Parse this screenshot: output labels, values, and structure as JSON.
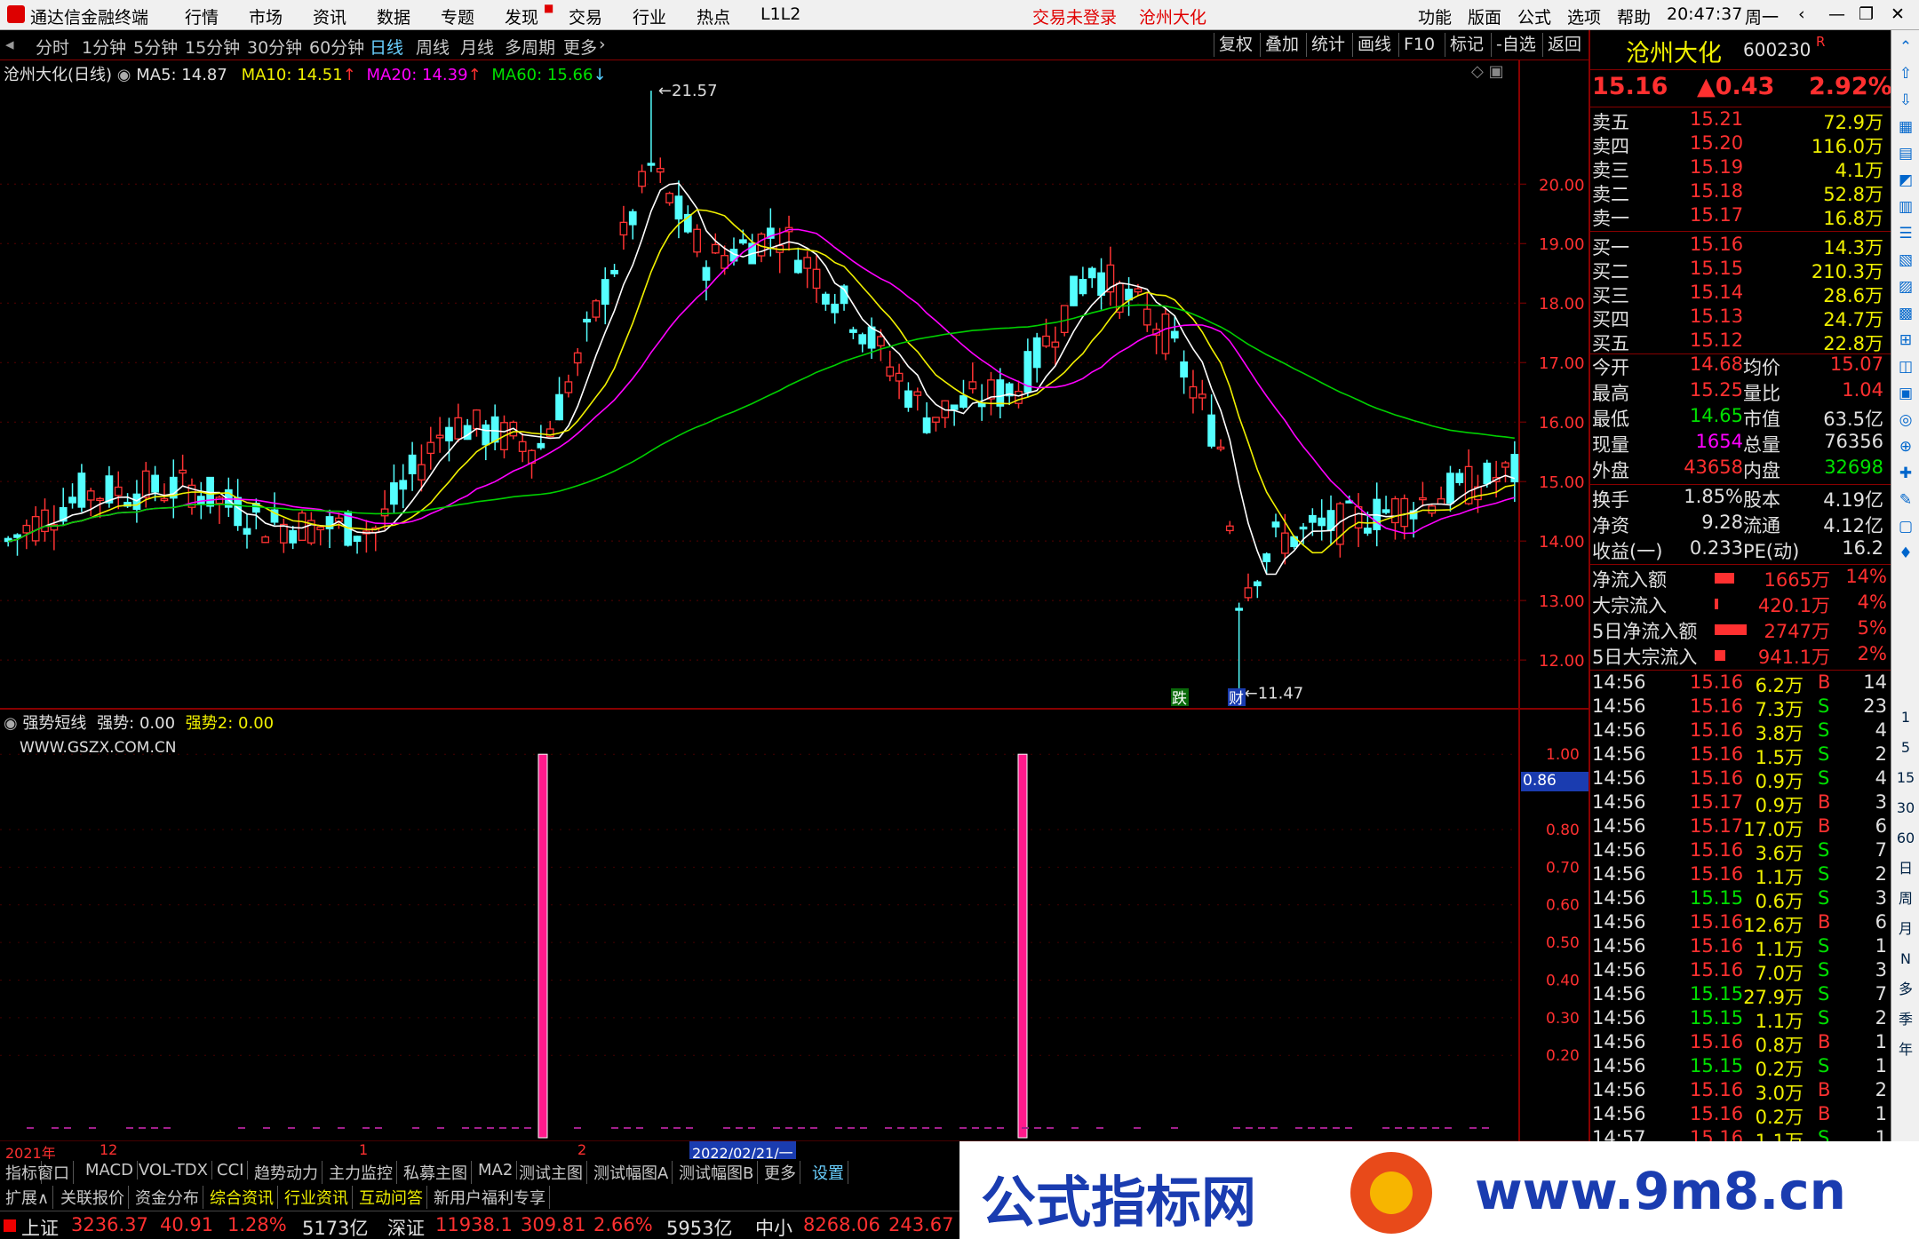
{
  "titlebar": {
    "app": "通达信金融终端",
    "menus": [
      "行情",
      "市场",
      "资讯",
      "数据",
      "专题",
      "发现",
      "交易",
      "行业",
      "热点",
      "L1L2"
    ],
    "status": "交易未登录",
    "stock": "沧州大化",
    "right_menus": [
      "功能",
      "版面",
      "公式",
      "选项",
      "帮助"
    ],
    "time": "20:47:37",
    "weekday": "周一"
  },
  "toolbar": {
    "periods": [
      "分时",
      "1分钟",
      "5分钟",
      "15分钟",
      "30分钟",
      "60分钟",
      "日线",
      "周线",
      "月线",
      "多周期",
      "更多"
    ],
    "active": "日线",
    "buttons": [
      "复权",
      "叠加",
      "统计",
      "画线",
      "F10",
      "标记",
      "-自选",
      "返回"
    ]
  },
  "main_legend": {
    "name": "沧州大化(日线)",
    "ma5": "MA5: 14.87",
    "ma10": "MA10: 14.51",
    "ma20": "MA20: 14.39",
    "ma60": "MA60: 15.66"
  },
  "price_axis": [
    "20.00",
    "19.00",
    "18.00",
    "17.00",
    "16.00",
    "15.00",
    "14.00",
    "13.00",
    "12.00"
  ],
  "annotations": {
    "high": "21.57",
    "low": "11.47",
    "tag1": "跌",
    "tag2": "财"
  },
  "sub_legend": {
    "name": "强势短线",
    "v1": "强势: 0.00",
    "v2": "强势2: 0.00",
    "site": "WWW.GSZX.COM.CN"
  },
  "sub_axis": [
    "1.00",
    "0.80",
    "0.70",
    "0.60",
    "0.50",
    "0.40",
    "0.30",
    "0.20"
  ],
  "sub_current": "0.86",
  "time_axis": {
    "year": "2021年",
    "m12": "12",
    "m1": "1",
    "m2": "2",
    "cursor": "2022/02/21/一"
  },
  "chart_data": {
    "type": "candlestick",
    "ohlc_high": 21.57,
    "ohlc_low": 11.47,
    "ylim": [
      11.3,
      21.9
    ],
    "ma5": 14.87,
    "ma10": 14.51,
    "ma20": 14.39,
    "ma60": 15.66,
    "signal_bars": [
      {
        "at": "2021-12",
        "value": 1.0
      },
      {
        "at": "2022-02",
        "value": 1.0
      }
    ],
    "sub_ylim": [
      0,
      1.05
    ]
  },
  "quote": {
    "name": "沧州大化",
    "code": "600230",
    "flag": "R",
    "price": "15.16",
    "change": "▲0.43",
    "pct": "2.92%"
  },
  "asks": [
    {
      "l": "卖五",
      "p": "15.21",
      "v": "72.9万"
    },
    {
      "l": "卖四",
      "p": "15.20",
      "v": "116.0万"
    },
    {
      "l": "卖三",
      "p": "15.19",
      "v": "4.1万"
    },
    {
      "l": "卖二",
      "p": "15.18",
      "v": "52.8万"
    },
    {
      "l": "卖一",
      "p": "15.17",
      "v": "16.8万"
    }
  ],
  "bids": [
    {
      "l": "买一",
      "p": "15.16",
      "v": "14.3万"
    },
    {
      "l": "买二",
      "p": "15.15",
      "v": "210.3万"
    },
    {
      "l": "买三",
      "p": "15.14",
      "v": "28.6万"
    },
    {
      "l": "买四",
      "p": "15.13",
      "v": "24.7万"
    },
    {
      "l": "买五",
      "p": "15.12",
      "v": "22.8万"
    }
  ],
  "stats": [
    {
      "a": "今开",
      "av": "14.68",
      "b": "均价",
      "bv": "15.07"
    },
    {
      "a": "最高",
      "av": "15.25",
      "b": "量比",
      "bv": "1.04"
    },
    {
      "a": "最低",
      "av": "14.65",
      "b": "市值",
      "bv": "63.5亿"
    },
    {
      "a": "现量",
      "av": "1654",
      "b": "总量",
      "bv": "76356"
    },
    {
      "a": "外盘",
      "av": "43658",
      "b": "内盘",
      "bv": "32698"
    }
  ],
  "stats2": [
    {
      "a": "换手",
      "av": "1.85%",
      "b": "股本",
      "bv": "4.19亿"
    },
    {
      "a": "净资",
      "av": "9.28",
      "b": "流通",
      "bv": "4.12亿"
    },
    {
      "a": "收益(一)",
      "av": "0.233",
      "b": "PE(动)",
      "bv": "16.2"
    }
  ],
  "flows": [
    {
      "l": "净流入额",
      "v": "1665万",
      "p": "14%"
    },
    {
      "l": "大宗流入",
      "v": "420.1万",
      "p": "4%"
    },
    {
      "l": "5日净流入额",
      "v": "2747万",
      "p": "5%"
    },
    {
      "l": "5日大宗流入",
      "v": "941.1万",
      "p": "2%"
    }
  ],
  "ticks": [
    [
      "14:56",
      "15.16",
      "6.2万",
      "B",
      "14"
    ],
    [
      "14:56",
      "15.16",
      "7.3万",
      "S",
      "23"
    ],
    [
      "14:56",
      "15.16",
      "3.8万",
      "S",
      "4"
    ],
    [
      "14:56",
      "15.16",
      "1.5万",
      "S",
      "2"
    ],
    [
      "14:56",
      "15.16",
      "0.9万",
      "S",
      "4"
    ],
    [
      "14:56",
      "15.17",
      "0.9万",
      "B",
      "3"
    ],
    [
      "14:56",
      "15.17",
      "17.0万",
      "B",
      "6"
    ],
    [
      "14:56",
      "15.16",
      "3.6万",
      "S",
      "7"
    ],
    [
      "14:56",
      "15.16",
      "1.1万",
      "S",
      "2"
    ],
    [
      "14:56",
      "15.15",
      "0.6万",
      "S",
      "3"
    ],
    [
      "14:56",
      "15.16",
      "12.6万",
      "B",
      "6"
    ],
    [
      "14:56",
      "15.16",
      "1.1万",
      "S",
      "1"
    ],
    [
      "14:56",
      "15.16",
      "7.0万",
      "S",
      "3"
    ],
    [
      "14:56",
      "15.15",
      "27.9万",
      "S",
      "7"
    ],
    [
      "14:56",
      "15.15",
      "1.1万",
      "S",
      "2"
    ],
    [
      "14:56",
      "15.16",
      "0.8万",
      "B",
      "1"
    ],
    [
      "14:56",
      "15.15",
      "0.2万",
      "S",
      "1"
    ],
    [
      "14:56",
      "15.16",
      "3.0万",
      "B",
      "2"
    ],
    [
      "14:56",
      "15.16",
      "0.2万",
      "B",
      "1"
    ],
    [
      "14:57",
      "15.16",
      "1.1万",
      "S",
      "1"
    ]
  ],
  "sidebar_labels": [
    "1",
    "5",
    "15",
    "30",
    "60",
    "日",
    "周",
    "月",
    "N",
    "多",
    "季",
    "年"
  ],
  "tabs1": [
    "指标",
    "窗口",
    "MACD",
    "VOL-TDX",
    "CCI",
    "趋势动力",
    "主力监控",
    "私募主图",
    "MA2",
    "测试主图",
    "测试幅图A",
    "测试幅图B",
    "更多",
    "设置"
  ],
  "tabs2": [
    "扩展∧",
    "关联报价",
    "资金分布",
    "综合资讯",
    "行业资讯",
    "互动问答",
    "新用户福利专享"
  ],
  "status": {
    "sh_label": "上证",
    "sh_val": "3236.37",
    "sh_chg": "40.91",
    "sh_pct": "1.28%",
    "sh_amt": "5173亿",
    "sz_label": "深证",
    "sz_val": "11938.1",
    "sz_chg": "309.81",
    "sz_pct": "2.66%",
    "sz_amt": "5953亿",
    "zx_label": "中小",
    "zx_val": "8268.06",
    "zx_chg": "243.67"
  },
  "banner": {
    "text": "公式指标网",
    "url": "www.9m8.cn"
  },
  "colors": {
    "up": "#ff3333",
    "down": "#54ffff",
    "ma5": "#ffffff",
    "ma10": "#f0f000",
    "ma20": "#ff00ff",
    "ma60": "#00d000",
    "signal": "#ff1a8c"
  }
}
